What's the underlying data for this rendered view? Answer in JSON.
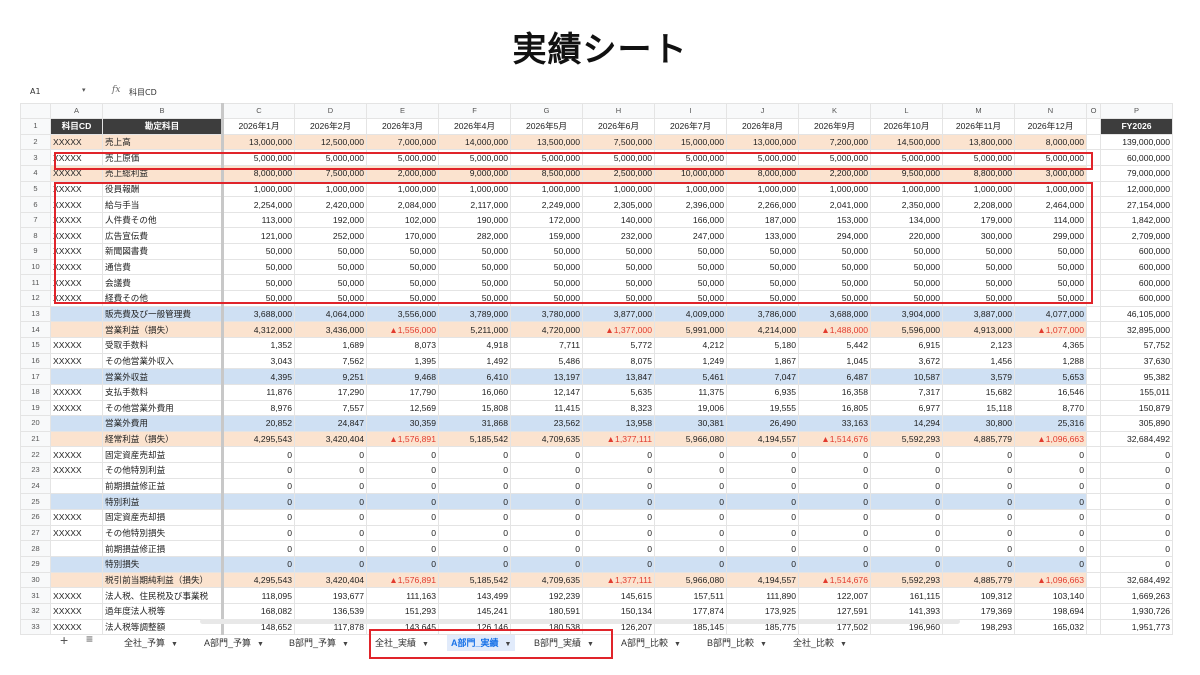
{
  "headline": "実績シート",
  "formula_bar": {
    "cell_ref": "A1",
    "fx": "fx",
    "value": "科目CD"
  },
  "columns": {
    "letters": [
      "",
      "A",
      "B",
      "C",
      "D",
      "E",
      "F",
      "G",
      "H",
      "I",
      "J",
      "K",
      "L",
      "M",
      "N",
      "O",
      "P"
    ]
  },
  "header_row": {
    "row": "1",
    "code": "科目CD",
    "name": "勘定科目",
    "months": [
      "2026年1月",
      "2026年2月",
      "2026年3月",
      "2026年4月",
      "2026年5月",
      "2026年6月",
      "2026年7月",
      "2026年8月",
      "2026年9月",
      "2026年10月",
      "2026年11月",
      "2026年12月"
    ],
    "fy": "FY2026"
  },
  "rows": [
    {
      "r": "2",
      "style": "peach",
      "code": "XXXXX",
      "name": "売上高",
      "m": [
        "13,000,000",
        "12,500,000",
        "7,000,000",
        "14,000,000",
        "13,500,000",
        "7,500,000",
        "15,000,000",
        "13,000,000",
        "7,200,000",
        "14,500,000",
        "13,800,000",
        "8,000,000"
      ],
      "fy": "139,000,000"
    },
    {
      "r": "3",
      "style": "",
      "code": "XXXXX",
      "name": "売上原価",
      "m": [
        "5,000,000",
        "5,000,000",
        "5,000,000",
        "5,000,000",
        "5,000,000",
        "5,000,000",
        "5,000,000",
        "5,000,000",
        "5,000,000",
        "5,000,000",
        "5,000,000",
        "5,000,000"
      ],
      "fy": "60,000,000"
    },
    {
      "r": "4",
      "style": "peach",
      "code": "XXXXX",
      "name": "売上総利益",
      "m": [
        "8,000,000",
        "7,500,000",
        "2,000,000",
        "9,000,000",
        "8,500,000",
        "2,500,000",
        "10,000,000",
        "8,000,000",
        "2,200,000",
        "9,500,000",
        "8,800,000",
        "3,000,000"
      ],
      "fy": "79,000,000"
    },
    {
      "r": "5",
      "style": "",
      "code": "XXXXX",
      "name": "役員報酬",
      "m": [
        "1,000,000",
        "1,000,000",
        "1,000,000",
        "1,000,000",
        "1,000,000",
        "1,000,000",
        "1,000,000",
        "1,000,000",
        "1,000,000",
        "1,000,000",
        "1,000,000",
        "1,000,000"
      ],
      "fy": "12,000,000"
    },
    {
      "r": "6",
      "style": "",
      "code": "XXXXX",
      "name": "給与手当",
      "m": [
        "2,254,000",
        "2,420,000",
        "2,084,000",
        "2,117,000",
        "2,249,000",
        "2,305,000",
        "2,396,000",
        "2,266,000",
        "2,041,000",
        "2,350,000",
        "2,208,000",
        "2,464,000"
      ],
      "fy": "27,154,000"
    },
    {
      "r": "7",
      "style": "",
      "code": "XXXXX",
      "name": "人件費その他",
      "m": [
        "113,000",
        "192,000",
        "102,000",
        "190,000",
        "172,000",
        "140,000",
        "166,000",
        "187,000",
        "153,000",
        "134,000",
        "179,000",
        "114,000"
      ],
      "fy": "1,842,000"
    },
    {
      "r": "8",
      "style": "",
      "code": "XXXXX",
      "name": "広告宣伝費",
      "m": [
        "121,000",
        "252,000",
        "170,000",
        "282,000",
        "159,000",
        "232,000",
        "247,000",
        "133,000",
        "294,000",
        "220,000",
        "300,000",
        "299,000"
      ],
      "fy": "2,709,000"
    },
    {
      "r": "9",
      "style": "",
      "code": "XXXXX",
      "name": "新聞図書費",
      "m": [
        "50,000",
        "50,000",
        "50,000",
        "50,000",
        "50,000",
        "50,000",
        "50,000",
        "50,000",
        "50,000",
        "50,000",
        "50,000",
        "50,000"
      ],
      "fy": "600,000"
    },
    {
      "r": "10",
      "style": "",
      "code": "XXXXX",
      "name": "通信費",
      "m": [
        "50,000",
        "50,000",
        "50,000",
        "50,000",
        "50,000",
        "50,000",
        "50,000",
        "50,000",
        "50,000",
        "50,000",
        "50,000",
        "50,000"
      ],
      "fy": "600,000"
    },
    {
      "r": "11",
      "style": "",
      "code": "XXXXX",
      "name": "会議費",
      "m": [
        "50,000",
        "50,000",
        "50,000",
        "50,000",
        "50,000",
        "50,000",
        "50,000",
        "50,000",
        "50,000",
        "50,000",
        "50,000",
        "50,000"
      ],
      "fy": "600,000"
    },
    {
      "r": "12",
      "style": "",
      "code": "XXXXX",
      "name": "経費その他",
      "m": [
        "50,000",
        "50,000",
        "50,000",
        "50,000",
        "50,000",
        "50,000",
        "50,000",
        "50,000",
        "50,000",
        "50,000",
        "50,000",
        "50,000"
      ],
      "fy": "600,000"
    },
    {
      "r": "13",
      "style": "blue",
      "code": "",
      "name": "販売費及び一般管理費",
      "m": [
        "3,688,000",
        "4,064,000",
        "3,556,000",
        "3,789,000",
        "3,780,000",
        "3,877,000",
        "4,009,000",
        "3,786,000",
        "3,688,000",
        "3,904,000",
        "3,887,000",
        "4,077,000"
      ],
      "fy": "46,105,000"
    },
    {
      "r": "14",
      "style": "peach",
      "code": "",
      "name": "営業利益（損失）",
      "m": [
        "4,312,000",
        "3,436,000",
        "▲1,556,000",
        "5,211,000",
        "4,720,000",
        "▲1,377,000",
        "5,991,000",
        "4,214,000",
        "▲1,488,000",
        "5,596,000",
        "4,913,000",
        "▲1,077,000"
      ],
      "fy": "32,895,000"
    },
    {
      "r": "15",
      "style": "",
      "code": "XXXXX",
      "name": "受取手数料",
      "m": [
        "1,352",
        "1,689",
        "8,073",
        "4,918",
        "7,711",
        "5,772",
        "4,212",
        "5,180",
        "5,442",
        "6,915",
        "2,123",
        "4,365"
      ],
      "fy": "57,752"
    },
    {
      "r": "16",
      "style": "",
      "code": "XXXXX",
      "name": "その他営業外収入",
      "m": [
        "3,043",
        "7,562",
        "1,395",
        "1,492",
        "5,486",
        "8,075",
        "1,249",
        "1,867",
        "1,045",
        "3,672",
        "1,456",
        "1,288"
      ],
      "fy": "37,630"
    },
    {
      "r": "17",
      "style": "blue",
      "code": "",
      "name": "営業外収益",
      "m": [
        "4,395",
        "9,251",
        "9,468",
        "6,410",
        "13,197",
        "13,847",
        "5,461",
        "7,047",
        "6,487",
        "10,587",
        "3,579",
        "5,653"
      ],
      "fy": "95,382"
    },
    {
      "r": "18",
      "style": "",
      "code": "XXXXX",
      "name": "支払手数料",
      "m": [
        "11,876",
        "17,290",
        "17,790",
        "16,060",
        "12,147",
        "5,635",
        "11,375",
        "6,935",
        "16,358",
        "7,317",
        "15,682",
        "16,546"
      ],
      "fy": "155,011"
    },
    {
      "r": "19",
      "style": "",
      "code": "XXXXX",
      "name": "その他営業外費用",
      "m": [
        "8,976",
        "7,557",
        "12,569",
        "15,808",
        "11,415",
        "8,323",
        "19,006",
        "19,555",
        "16,805",
        "6,977",
        "15,118",
        "8,770"
      ],
      "fy": "150,879"
    },
    {
      "r": "20",
      "style": "blue",
      "code": "",
      "name": "営業外費用",
      "m": [
        "20,852",
        "24,847",
        "30,359",
        "31,868",
        "23,562",
        "13,958",
        "30,381",
        "26,490",
        "33,163",
        "14,294",
        "30,800",
        "25,316"
      ],
      "fy": "305,890"
    },
    {
      "r": "21",
      "style": "peach",
      "code": "",
      "name": "経常利益（損失）",
      "m": [
        "4,295,543",
        "3,420,404",
        "▲1,576,891",
        "5,185,542",
        "4,709,635",
        "▲1,377,111",
        "5,966,080",
        "4,194,557",
        "▲1,514,676",
        "5,592,293",
        "4,885,779",
        "▲1,096,663"
      ],
      "fy": "32,684,492"
    },
    {
      "r": "22",
      "style": "",
      "code": "XXXXX",
      "name": "固定資産売却益",
      "m": [
        "0",
        "0",
        "0",
        "0",
        "0",
        "0",
        "0",
        "0",
        "0",
        "0",
        "0",
        "0"
      ],
      "fy": "0"
    },
    {
      "r": "23",
      "style": "",
      "code": "XXXXX",
      "name": "その他特別利益",
      "m": [
        "0",
        "0",
        "0",
        "0",
        "0",
        "0",
        "0",
        "0",
        "0",
        "0",
        "0",
        "0"
      ],
      "fy": "0"
    },
    {
      "r": "24",
      "style": "",
      "code": "",
      "name": "前期損益修正益",
      "m": [
        "0",
        "0",
        "0",
        "0",
        "0",
        "0",
        "0",
        "0",
        "0",
        "0",
        "0",
        "0"
      ],
      "fy": "0"
    },
    {
      "r": "25",
      "style": "blue",
      "code": "",
      "name": "特別利益",
      "m": [
        "0",
        "0",
        "0",
        "0",
        "0",
        "0",
        "0",
        "0",
        "0",
        "0",
        "0",
        "0"
      ],
      "fy": "0"
    },
    {
      "r": "26",
      "style": "",
      "code": "XXXXX",
      "name": "固定資産売却損",
      "m": [
        "0",
        "0",
        "0",
        "0",
        "0",
        "0",
        "0",
        "0",
        "0",
        "0",
        "0",
        "0"
      ],
      "fy": "0"
    },
    {
      "r": "27",
      "style": "",
      "code": "XXXXX",
      "name": "その他特別損失",
      "m": [
        "0",
        "0",
        "0",
        "0",
        "0",
        "0",
        "0",
        "0",
        "0",
        "0",
        "0",
        "0"
      ],
      "fy": "0"
    },
    {
      "r": "28",
      "style": "",
      "code": "",
      "name": "前期損益修正損",
      "m": [
        "0",
        "0",
        "0",
        "0",
        "0",
        "0",
        "0",
        "0",
        "0",
        "0",
        "0",
        "0"
      ],
      "fy": "0"
    },
    {
      "r": "29",
      "style": "blue",
      "code": "",
      "name": "特別損失",
      "m": [
        "0",
        "0",
        "0",
        "0",
        "0",
        "0",
        "0",
        "0",
        "0",
        "0",
        "0",
        "0"
      ],
      "fy": "0"
    },
    {
      "r": "30",
      "style": "peach",
      "code": "",
      "name": "税引前当期純利益（損失）",
      "m": [
        "4,295,543",
        "3,420,404",
        "▲1,576,891",
        "5,185,542",
        "4,709,635",
        "▲1,377,111",
        "5,966,080",
        "4,194,557",
        "▲1,514,676",
        "5,592,293",
        "4,885,779",
        "▲1,096,663"
      ],
      "fy": "32,684,492"
    },
    {
      "r": "31",
      "style": "",
      "code": "XXXXX",
      "name": "法人税、住民税及び事業税",
      "m": [
        "118,095",
        "193,677",
        "111,163",
        "143,499",
        "192,239",
        "145,615",
        "157,511",
        "111,890",
        "122,007",
        "161,115",
        "109,312",
        "103,140"
      ],
      "fy": "1,669,263"
    },
    {
      "r": "32",
      "style": "",
      "code": "XXXXX",
      "name": "過年度法人税等",
      "m": [
        "168,082",
        "136,539",
        "151,293",
        "145,241",
        "180,591",
        "150,134",
        "177,874",
        "173,925",
        "127,591",
        "141,393",
        "179,369",
        "198,694"
      ],
      "fy": "1,930,726"
    },
    {
      "r": "33",
      "style": "",
      "code": "XXXXX",
      "name": "法人税等調整額",
      "m": [
        "148,652",
        "117,878",
        "143,645",
        "126,146",
        "180,538",
        "126,207",
        "185,145",
        "185,775",
        "177,502",
        "196,960",
        "198,293",
        "165,032"
      ],
      "fy": "1,951,773"
    }
  ],
  "tabs": {
    "add": "+",
    "menu": "≡",
    "items": [
      "全社_予算",
      "A部門_予算",
      "B部門_予算",
      "全社_実績",
      "A部門_実績",
      "B部門_実績",
      "A部門_比較",
      "B部門_比較",
      "全社_比較"
    ],
    "active_index": 4
  },
  "colors": {
    "peach": "#fbe3cf",
    "blue": "#cfe0f3",
    "negative": "#e23b2e",
    "highlight_box": "#e0242a",
    "header_dark": "#3d3d3d",
    "active_tab": "#1a73e8"
  }
}
